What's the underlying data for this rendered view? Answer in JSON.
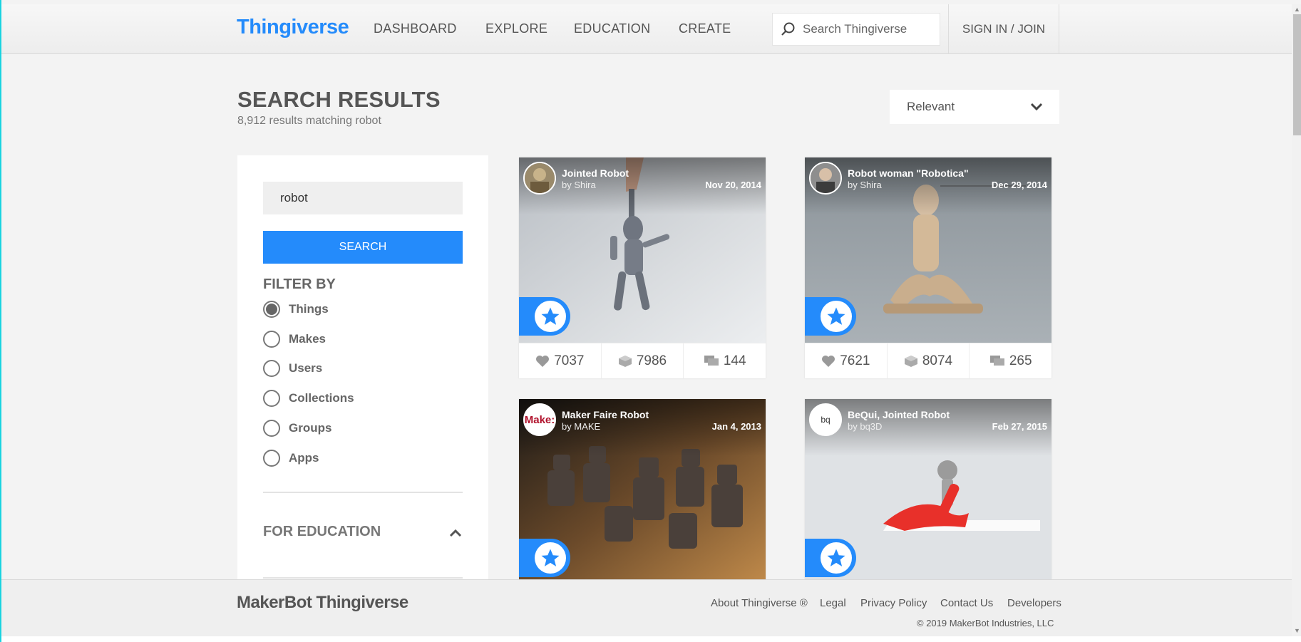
{
  "header": {
    "logo": "Thingiverse",
    "nav": [
      "DASHBOARD",
      "EXPLORE",
      "EDUCATION",
      "CREATE"
    ],
    "search_placeholder": "Search Thingiverse",
    "sign_in": "SIGN IN / JOIN"
  },
  "results": {
    "title": "SEARCH RESULTS",
    "subtitle": "8,912 results matching robot",
    "sort": "Relevant"
  },
  "sidebar": {
    "search_value": "robot",
    "search_button": "SEARCH",
    "filter_title": "FILTER BY",
    "filters": [
      "Things",
      "Makes",
      "Users",
      "Collections",
      "Groups",
      "Apps"
    ],
    "selected_filter": "Things",
    "education_title": "FOR EDUCATION"
  },
  "cards": [
    {
      "title": "Jointed Robot",
      "author": "by Shira",
      "date": "Nov 20, 2014",
      "likes": "7037",
      "collects": "7986",
      "comments": "144"
    },
    {
      "title": "Robot woman \"Robotica\"",
      "author": "by Shira",
      "date": "Dec 29, 2014",
      "likes": "7621",
      "collects": "8074",
      "comments": "265"
    },
    {
      "title": "Maker Faire Robot",
      "author": "by MAKE",
      "date": "Jan 4, 2013",
      "avatar_text": "Make:"
    },
    {
      "title": "BeQui, Jointed Robot",
      "author": "by bq3D",
      "date": "Feb 27, 2015",
      "avatar_text": "bq"
    }
  ],
  "footer": {
    "logo": "MakerBot Thingiverse",
    "links": [
      "About Thingiverse ®",
      "Legal",
      "Privacy Policy",
      "Contact Us",
      "Developers"
    ],
    "copyright": "© 2019 MakerBot Industries, LLC"
  },
  "colors": {
    "accent": "#248bfb",
    "background": "#f3f3f3"
  }
}
